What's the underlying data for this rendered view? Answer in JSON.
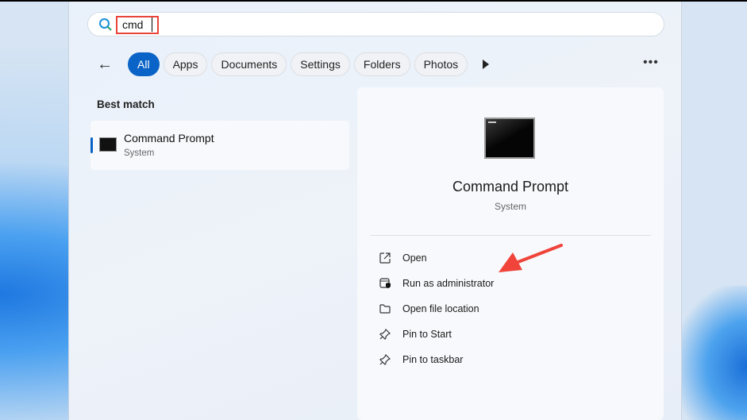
{
  "search": {
    "query": "cmd"
  },
  "filters": [
    "All",
    "Apps",
    "Documents",
    "Settings",
    "Folders",
    "Photos"
  ],
  "best_match": {
    "heading": "Best match",
    "title": "Command Prompt",
    "subtitle": "System"
  },
  "detail": {
    "title": "Command Prompt",
    "subtitle": "System",
    "actions": [
      "Open",
      "Run as administrator",
      "Open file location",
      "Pin to Start",
      "Pin to taskbar"
    ]
  },
  "colors": {
    "accent": "#0a63c6",
    "annotation": "#e8443a"
  }
}
